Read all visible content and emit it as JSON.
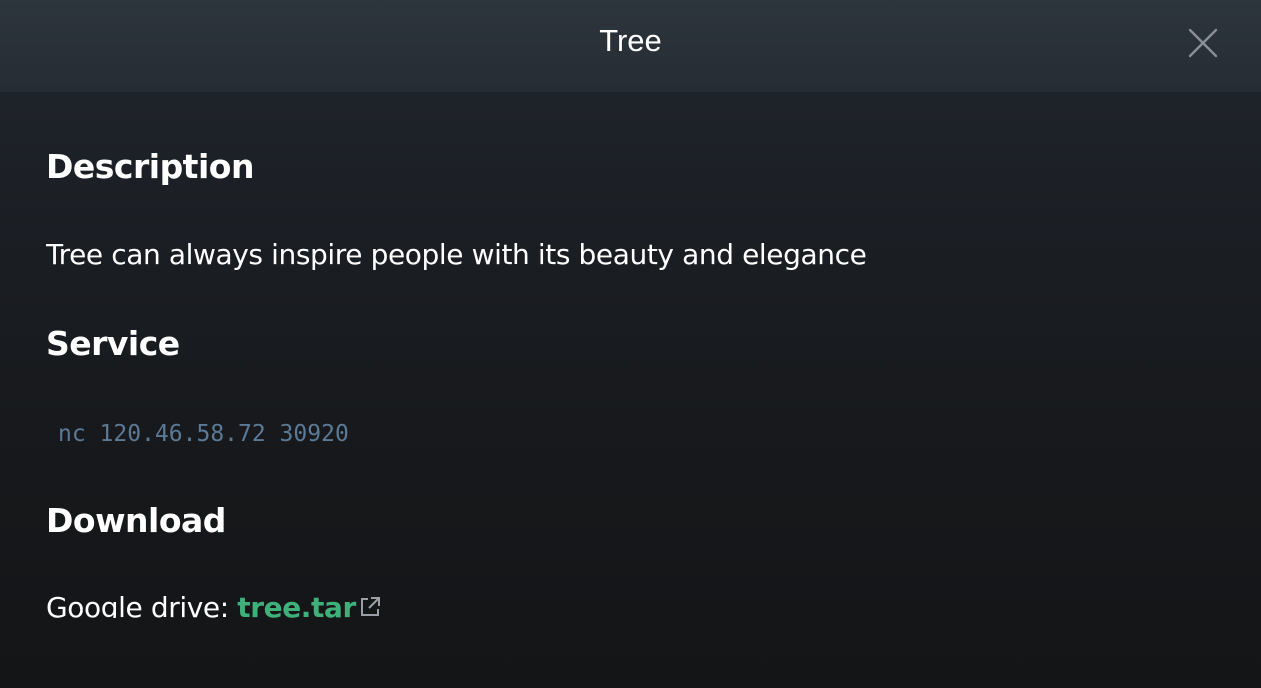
{
  "modal": {
    "title": "Tree",
    "close_icon": "close-icon"
  },
  "sections": {
    "description": {
      "heading": "Description",
      "text": "Tree can always inspire people with its beauty and elegance"
    },
    "service": {
      "heading": "Service",
      "command": "nc 120.46.58.72 30920"
    },
    "download": {
      "heading": "Download",
      "label": "Google drive: ",
      "link_text": "tree.tar",
      "link_icon": "external-link-icon"
    }
  },
  "colors": {
    "link": "#3fb07a",
    "code": "#5c7a96",
    "header": "#2d353d",
    "background": "#151619"
  }
}
